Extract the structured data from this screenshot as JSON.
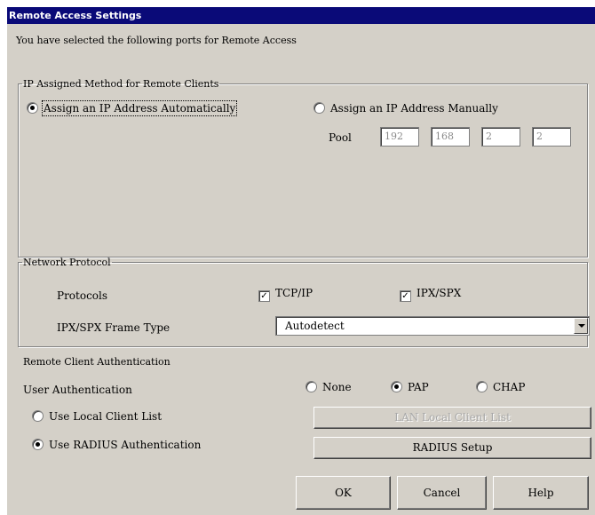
{
  "window": {
    "title": "Remote Access Settings"
  },
  "intro": "You have selected the following ports for Remote Access",
  "ip_group": {
    "legend": "IP Assigned Method for Remote Clients",
    "auto_label": "Assign an IP Address Automatically",
    "auto_selected": true,
    "manual_label": "Assign an IP Address Manually",
    "manual_selected": false,
    "pool_label": "Pool",
    "octets": [
      "192",
      "168",
      "2",
      "2"
    ]
  },
  "protocol_group": {
    "legend": "Network Protocol",
    "protocols_label": "Protocols",
    "tcpip_label": "TCP/IP",
    "tcpip_checked": true,
    "ipxspx_label": "IPX/SPX",
    "ipxspx_checked": true,
    "frame_type_label": "IPX/SPX Frame Type",
    "frame_type_value": "Autodetect"
  },
  "auth_group": {
    "legend": "Remote Client Authentication",
    "user_auth_label": "User Authentication",
    "none_label": "None",
    "pap_label": "PAP",
    "chap_label": "CHAP",
    "selected_auth": "PAP",
    "local_list_label": "Use Local Client List",
    "radius_label": "Use RADIUS Authentication",
    "radius_selected": true,
    "lan_list_button": "LAN Local Client List",
    "radius_setup_button": "RADIUS Setup"
  },
  "buttons": {
    "ok": "OK",
    "cancel": "Cancel",
    "help": "Help"
  }
}
